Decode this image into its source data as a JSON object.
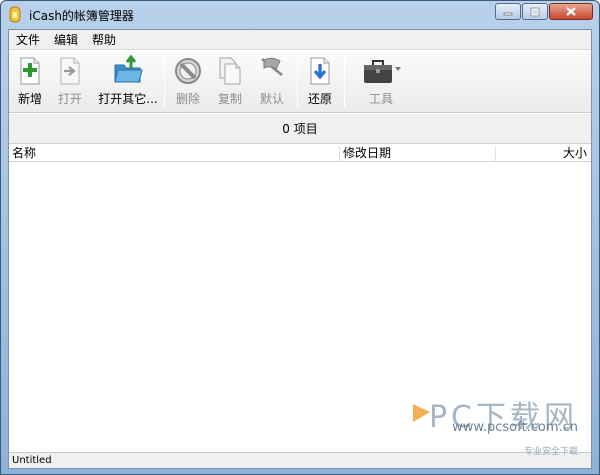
{
  "window": {
    "title": "iCash的帐簿管理器"
  },
  "menu": [
    "文件",
    "编辑",
    "帮助"
  ],
  "toolbar": {
    "new": "新增",
    "open": "打开",
    "open_other": "打开其它...",
    "delete": "删除",
    "copy": "复制",
    "default": "默认",
    "restore": "还原",
    "tools": "工具"
  },
  "item_count": "0 项目",
  "columns": {
    "name": "名称",
    "modified": "修改日期",
    "size": "大小"
  },
  "status": "Untitled",
  "watermark": {
    "main": "PC下载网",
    "url": "www.pcsoft.com.cn",
    "sub": "专业安全下载"
  },
  "colors": {
    "accent_green": "#2f9a2f",
    "folder": "#5aa6dc",
    "restore_blue": "#2b6fd0"
  }
}
